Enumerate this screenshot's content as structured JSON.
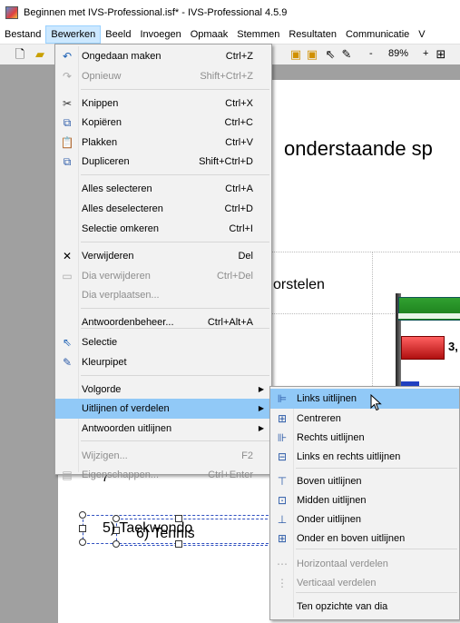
{
  "window": {
    "title": "Beginnen met IVS-Professional.isf* - IVS-Professional 4.5.9"
  },
  "menubar": [
    "Bestand",
    "Bewerken",
    "Beeld",
    "Invoegen",
    "Opmaak",
    "Stemmen",
    "Resultaten",
    "Communicatie",
    "V"
  ],
  "toolbar": {
    "zoom": "89%",
    "minus": "-",
    "plus": "+"
  },
  "slide": {
    "title": "onderstaande sp",
    "voorstellen": "orstelen",
    "value_label": "3,",
    "item5": "5) Taekwondo",
    "item6": "6) Tennis",
    "partial": "7"
  },
  "edit_menu": {
    "items": [
      {
        "label": "Ongedaan maken",
        "shortcut": "Ctrl+Z",
        "icon": "undo-icon",
        "disabled": false
      },
      {
        "label": "Opnieuw",
        "shortcut": "Shift+Ctrl+Z",
        "icon": "redo-icon",
        "disabled": true
      },
      {
        "label": "Knippen",
        "shortcut": "Ctrl+X",
        "icon": "cut-icon",
        "disabled": false
      },
      {
        "label": "Kopiëren",
        "shortcut": "Ctrl+C",
        "icon": "copy-icon",
        "disabled": false
      },
      {
        "label": "Plakken",
        "shortcut": "Ctrl+V",
        "icon": "paste-icon",
        "disabled": false
      },
      {
        "label": "Dupliceren",
        "shortcut": "Shift+Ctrl+D",
        "icon": "duplicate-icon",
        "disabled": false
      },
      {
        "label": "Alles selecteren",
        "shortcut": "Ctrl+A",
        "disabled": false
      },
      {
        "label": "Alles deselecteren",
        "shortcut": "Ctrl+D",
        "disabled": false
      },
      {
        "label": "Selectie omkeren",
        "shortcut": "Ctrl+I",
        "disabled": false
      },
      {
        "label": "Verwijderen",
        "shortcut": "Del",
        "icon": "delete-icon",
        "disabled": false
      },
      {
        "label": "Dia verwijderen",
        "shortcut": "Ctrl+Del",
        "icon": "delete-slide-icon",
        "disabled": true
      },
      {
        "label": "Dia verplaatsen...",
        "shortcut": "",
        "disabled": true
      },
      {
        "label": "Antwoordenbeheer...",
        "shortcut": "Ctrl+Alt+A",
        "disabled": false
      },
      {
        "label": "Selectie",
        "shortcut": "",
        "icon": "pointer-icon",
        "disabled": false
      },
      {
        "label": "Kleurpipet",
        "shortcut": "",
        "icon": "eyedropper-icon",
        "disabled": false
      },
      {
        "label": "Volgorde",
        "shortcut": "",
        "submenu": true,
        "disabled": false
      },
      {
        "label": "Uitlijnen of verdelen",
        "shortcut": "",
        "submenu": true,
        "disabled": false,
        "highlighted": true
      },
      {
        "label": "Antwoorden uitlijnen",
        "shortcut": "",
        "submenu": true,
        "disabled": false
      },
      {
        "label": "Wijzigen...",
        "shortcut": "F2",
        "disabled": true
      },
      {
        "label": "Eigenschappen...",
        "shortcut": "Ctrl+Enter",
        "icon": "properties-icon",
        "disabled": true
      }
    ]
  },
  "align_menu": {
    "items": [
      {
        "label": "Links uitlijnen",
        "icon": "align-left-icon",
        "highlighted": true,
        "disabled": false
      },
      {
        "label": "Centreren",
        "icon": "align-center-icon",
        "disabled": false
      },
      {
        "label": "Rechts uitlijnen",
        "icon": "align-right-icon",
        "disabled": false
      },
      {
        "label": "Links en rechts uitlijnen",
        "icon": "align-left-right-icon",
        "disabled": false
      },
      {
        "label": "Boven uitlijnen",
        "icon": "align-top-icon",
        "disabled": false
      },
      {
        "label": "Midden uitlijnen",
        "icon": "align-middle-icon",
        "disabled": false
      },
      {
        "label": "Onder uitlijnen",
        "icon": "align-bottom-icon",
        "disabled": false
      },
      {
        "label": "Onder en boven uitlijnen",
        "icon": "align-top-bottom-icon",
        "disabled": false
      },
      {
        "label": "Horizontaal verdelen",
        "icon": "distribute-horizontal-icon",
        "disabled": true
      },
      {
        "label": "Verticaal verdelen",
        "icon": "distribute-vertical-icon",
        "disabled": true
      },
      {
        "label": "Ten opzichte van dia",
        "disabled": false
      }
    ]
  },
  "colors": {
    "highlight": "#91c9f7",
    "menu_bg": "#f2f2f2",
    "disabled": "#8d8d8d",
    "workspace": "#a0a0a0"
  }
}
